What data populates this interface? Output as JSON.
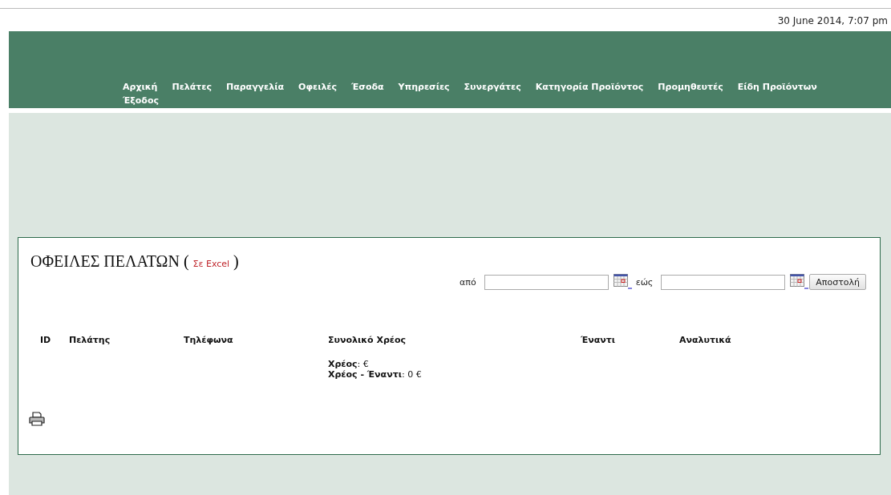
{
  "datetime": "30 June 2014, 7:07 pm",
  "nav": [
    "Αρχική",
    "Πελάτες",
    "Παραγγελία",
    "Οφειλές",
    "Έσοδα",
    "Υπηρεσίες",
    "Συνεργάτες",
    "Κατηγορία Προϊόντος",
    "Προμηθευτές",
    "Είδη Προϊόντων",
    "Έξοδος"
  ],
  "panel": {
    "title": "ΟΦΕΙΛΕΣ ΠΕΛΑΤΩΝ",
    "open_paren": "(",
    "excel_link": "Σε Excel",
    "close_paren": ")",
    "filter": {
      "from_label": "από",
      "to_label": "εώς",
      "submit": "Αποστολή"
    },
    "table": {
      "columns": [
        "ID",
        "Πελάτης",
        "Τηλέφωνα",
        "Συνολικό Χρέος",
        "Έναντι",
        "Αναλυτικά"
      ]
    },
    "summary": [
      "**Χρέος**: €",
      "**Χρέος - Έναντι**: 0 €"
    ]
  }
}
